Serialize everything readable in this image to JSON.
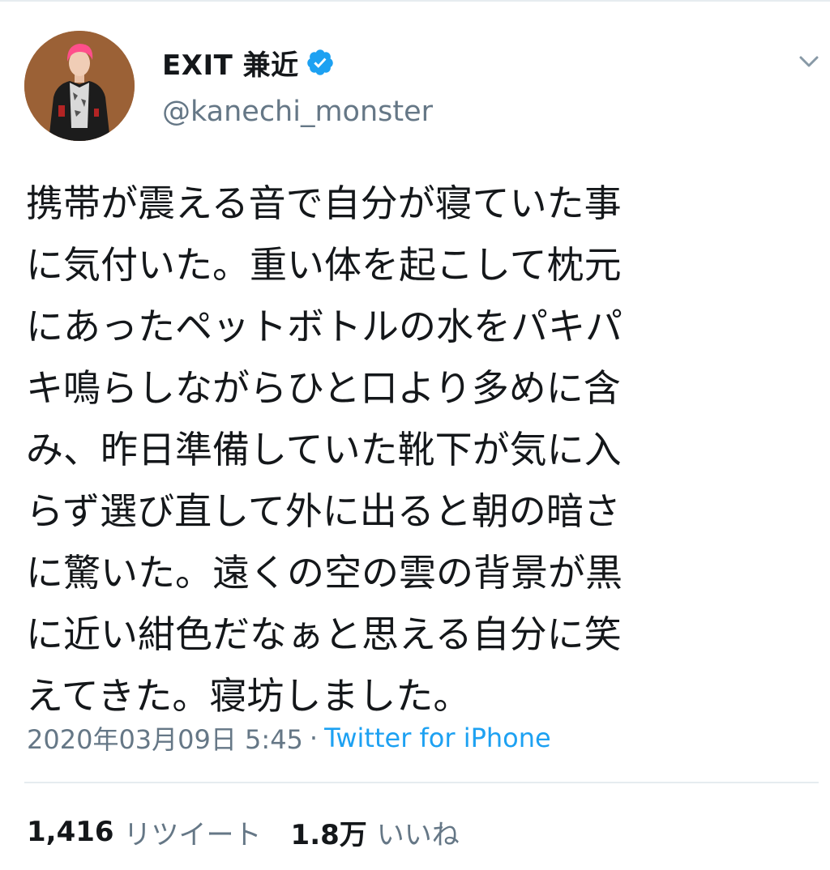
{
  "tweet": {
    "author": {
      "display_name": "EXIT 兼近",
      "handle": "@kanechi_monster",
      "verified": true
    },
    "text_lines": [
      "携帯が震える音で自分が寝ていた事",
      "に気付いた。重い体を起こして枕元",
      "にあったペットボトルの水をパキパ",
      "キ鳴らしながらひと口より多めに含",
      "み、昨日準備していた靴下が気に入",
      "らず選び直して外に出ると朝の暗さ",
      "に驚いた。遠くの空の雲の背景が黒",
      "に近い紺色だなぁと思える自分に笑",
      "えてきた。寝坊しました。"
    ],
    "timestamp": "2020年03月09日 5:45",
    "separator": "·",
    "source": "Twitter for iPhone",
    "stats": {
      "retweets": {
        "count": "1,416",
        "label": "リツイート"
      },
      "likes": {
        "count": "1.8万",
        "label": "いいね"
      }
    }
  },
  "colors": {
    "text": "#14171a",
    "secondary": "#657786",
    "link": "#1da1f2",
    "verified": "#1da1f2",
    "divider": "#e6ecf0"
  },
  "icons": {
    "verified": "verified-badge-icon",
    "caret": "chevron-down-icon"
  }
}
